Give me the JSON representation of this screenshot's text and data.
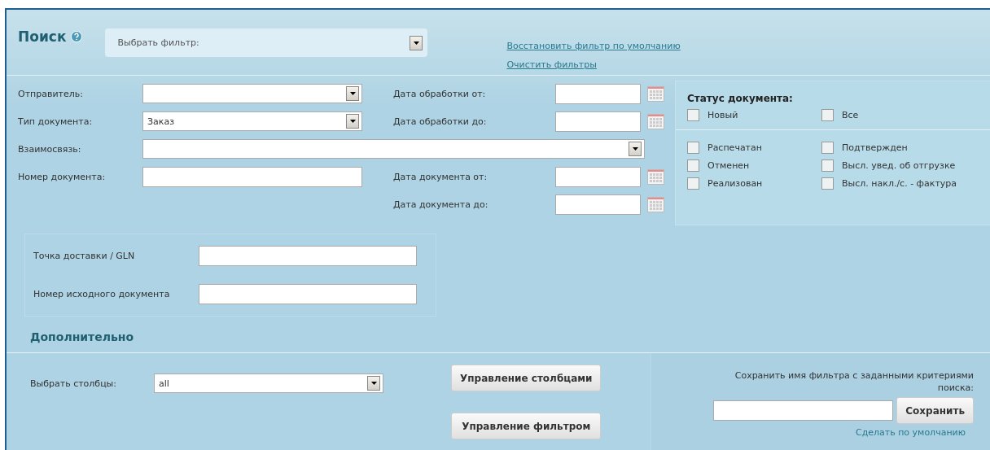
{
  "search": {
    "title": "Поиск",
    "filter_select": {
      "placeholder": "Выбрать фильтр:"
    },
    "links": [
      "Восстановить фильтр по умолчанию",
      "Очистить фильтры"
    ]
  },
  "fields": [
    {
      "label": "Отправитель:",
      "kind": "select"
    },
    {
      "label": "Тип документа:",
      "kind": "select",
      "value": "Заказ"
    },
    {
      "label": "Взаимосвязь:",
      "kind": "wide-select"
    },
    {
      "label": "Номер документа:",
      "kind": "text"
    }
  ],
  "dates": [
    {
      "label": "Дата обработки от:"
    },
    {
      "label": "Дата обработки до:"
    },
    {
      "label": "Дата документа от:"
    },
    {
      "label": "Дата документа до:"
    }
  ],
  "status": {
    "title": "Статус документа:",
    "top": [
      {
        "label": "Новый",
        "checked": false
      },
      {
        "label": "Все",
        "checked": false
      }
    ],
    "items": [
      {
        "label": "Распечатан",
        "checked": false
      },
      {
        "label": "Подтвержден",
        "checked": false
      },
      {
        "label": "Отменен",
        "checked": false
      },
      {
        "label": "Высл. увед. об отгрузке",
        "checked": false
      },
      {
        "label": "Реализован",
        "checked": false
      },
      {
        "label": "Высл. накл./с. - фактура",
        "checked": false
      }
    ]
  },
  "extra_fields": [
    {
      "label": "Точка доставки / GLN"
    },
    {
      "label": "Номер исходного документа"
    }
  ],
  "additional": {
    "title": "Дополнительно",
    "columns_label": "Выбрать столбцы:",
    "columns_value": "all",
    "buttons": [
      "Управление столбцами",
      "Управление фильтром"
    ],
    "save": {
      "caption": "Сохранить имя фильтра с заданными критериями поиска:",
      "button": "Сохранить",
      "link": "Сделать по умолчанию"
    }
  }
}
